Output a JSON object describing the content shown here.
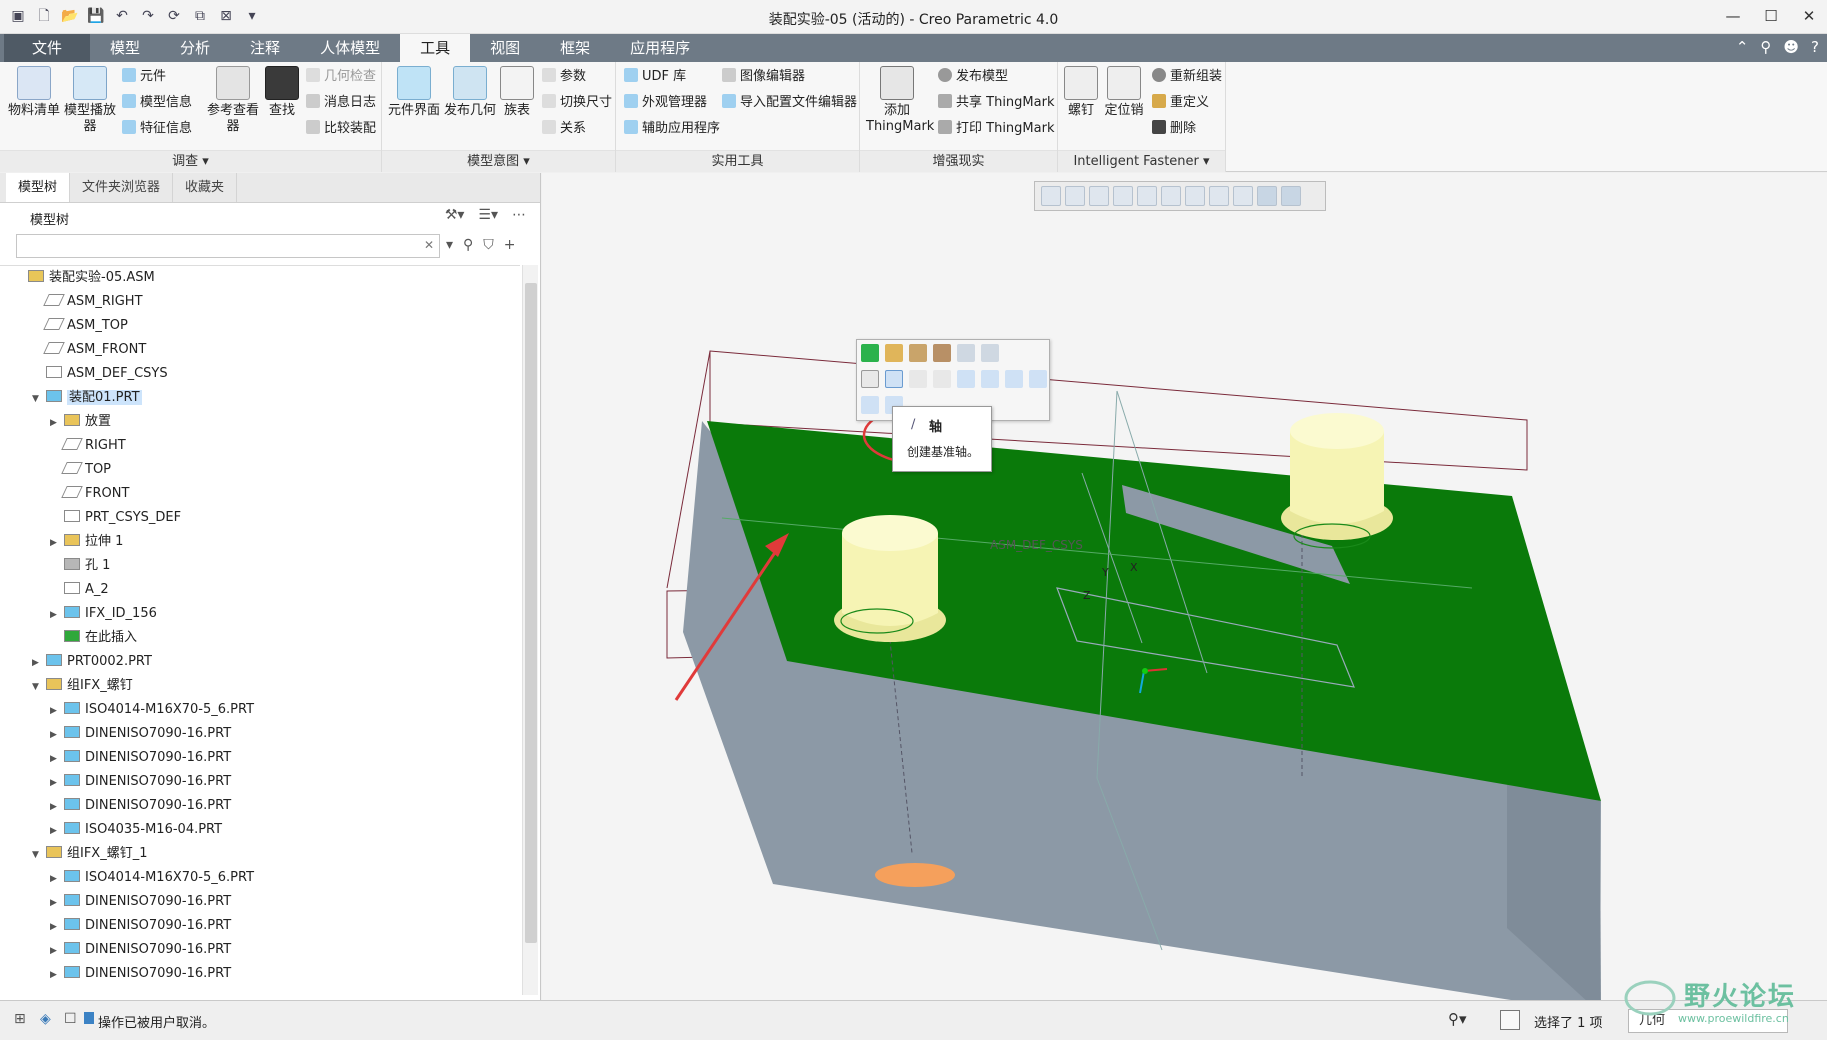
{
  "window": {
    "title": "装配实验-05 (活动的) - Creo Parametric 4.0"
  },
  "tabs": [
    {
      "label": "文件"
    },
    {
      "label": "模型"
    },
    {
      "label": "分析"
    },
    {
      "label": "注释"
    },
    {
      "label": "人体模型"
    },
    {
      "label": "工具"
    },
    {
      "label": "视图"
    },
    {
      "label": "框架"
    },
    {
      "label": "应用程序"
    }
  ],
  "ribbon": {
    "investigate": {
      "label": "调查 ▾",
      "bom": "物料清单",
      "model_player": "模型播放器",
      "component": "元件",
      "model_info": "模型信息",
      "feature_info": "特征信息",
      "ref_viewer": "参考查看器",
      "find": "查找",
      "geom_check": "几何检查",
      "msg_log": "消息日志",
      "compare_asm": "比较装配"
    },
    "model_intent": {
      "label": "模型意图 ▾",
      "component_interface": "元件界面",
      "publish_geom": "发布几何",
      "family_table": "族表",
      "params": "参数",
      "switch_dims": "切换尺寸",
      "relations": "关系"
    },
    "utilities": {
      "label": "实用工具",
      "udf_lib": "UDF 库",
      "appearance_mgr": "外观管理器",
      "aux_apps": "辅助应用程序",
      "image_editor": "图像编辑器",
      "import_config_editor": "导入配置文件编辑器"
    },
    "ar": {
      "label": "增强现实",
      "add_thingmark": "添加 ThingMark",
      "publish_model": "发布模型",
      "share_thingmark": "共享 ThingMark",
      "print_thingmark": "打印 ThingMark"
    },
    "fastener": {
      "label": "Intelligent Fastener ▾",
      "screw": "螺钉",
      "pin": "定位销",
      "reassemble": "重新组装",
      "redefine": "重定义",
      "delete": "删除"
    }
  },
  "panel": {
    "tabs": [
      "模型树",
      "文件夹浏览器",
      "收藏夹"
    ],
    "header": "模型树",
    "search_value": ""
  },
  "tree": [
    {
      "label": "装配实验-05.ASM",
      "level": 0,
      "toggle": "",
      "icon": "asm"
    },
    {
      "label": "ASM_RIGHT",
      "level": 1,
      "toggle": "",
      "icon": "plane"
    },
    {
      "label": "ASM_TOP",
      "level": 1,
      "toggle": "",
      "icon": "plane"
    },
    {
      "label": "ASM_FRONT",
      "level": 1,
      "toggle": "",
      "icon": "plane"
    },
    {
      "label": "ASM_DEF_CSYS",
      "level": 1,
      "toggle": "",
      "icon": "csys"
    },
    {
      "label": "装配01.PRT",
      "level": 1,
      "toggle": "▼",
      "icon": "part",
      "selected": true
    },
    {
      "label": "放置",
      "level": 2,
      "toggle": "▶",
      "icon": "folder"
    },
    {
      "label": "RIGHT",
      "level": 2,
      "toggle": "",
      "icon": "plane"
    },
    {
      "label": "TOP",
      "level": 2,
      "toggle": "",
      "icon": "plane"
    },
    {
      "label": "FRONT",
      "level": 2,
      "toggle": "",
      "icon": "plane"
    },
    {
      "label": "PRT_CSYS_DEF",
      "level": 2,
      "toggle": "",
      "icon": "csys"
    },
    {
      "label": "拉伸 1",
      "level": 2,
      "toggle": "▶",
      "icon": "extrude"
    },
    {
      "label": "孔 1",
      "level": 2,
      "toggle": "",
      "icon": "hole"
    },
    {
      "label": "A_2",
      "level": 2,
      "toggle": "",
      "icon": "axis"
    },
    {
      "label": "IFX_ID_156",
      "level": 2,
      "toggle": "▶",
      "icon": "part"
    },
    {
      "label": "在此插入",
      "level": 2,
      "toggle": "",
      "icon": "insert"
    },
    {
      "label": "PRT0002.PRT",
      "level": 1,
      "toggle": "▶",
      "icon": "part"
    },
    {
      "label": "组IFX_螺钉",
      "level": 1,
      "toggle": "▼",
      "icon": "group"
    },
    {
      "label": "ISO4014-M16X70-5_6.PRT",
      "level": 2,
      "toggle": "▶",
      "icon": "part"
    },
    {
      "label": "DINENISO7090-16.PRT",
      "level": 2,
      "toggle": "▶",
      "icon": "part"
    },
    {
      "label": "DINENISO7090-16.PRT",
      "level": 2,
      "toggle": "▶",
      "icon": "part"
    },
    {
      "label": "DINENISO7090-16.PRT",
      "level": 2,
      "toggle": "▶",
      "icon": "part"
    },
    {
      "label": "DINENISO7090-16.PRT",
      "level": 2,
      "toggle": "▶",
      "icon": "part"
    },
    {
      "label": "ISO4035-M16-04.PRT",
      "level": 2,
      "toggle": "▶",
      "icon": "part"
    },
    {
      "label": "组IFX_螺钉_1",
      "level": 1,
      "toggle": "▼",
      "icon": "group"
    },
    {
      "label": "ISO4014-M16X70-5_6.PRT",
      "level": 2,
      "toggle": "▶",
      "icon": "part"
    },
    {
      "label": "DINENISO7090-16.PRT",
      "level": 2,
      "toggle": "▶",
      "icon": "part"
    },
    {
      "label": "DINENISO7090-16.PRT",
      "level": 2,
      "toggle": "▶",
      "icon": "part"
    },
    {
      "label": "DINENISO7090-16.PRT",
      "level": 2,
      "toggle": "▶",
      "icon": "part"
    },
    {
      "label": "DINENISO7090-16.PRT",
      "level": 2,
      "toggle": "▶",
      "icon": "part"
    }
  ],
  "tooltip": {
    "title": "轴",
    "desc": "创建基准轴。"
  },
  "graphics": {
    "csys_label": "ASM_DEF_CSYS",
    "axis_x": "X",
    "axis_y": "Y",
    "axis_z": "Z"
  },
  "status": {
    "message": "操作已被用户取消。",
    "selection": "选择了 1 项",
    "filter": "几何"
  },
  "watermark": {
    "brand": "野火论坛",
    "url": "www.proewildfire.cn"
  },
  "colors": {
    "tab_bar": "#6e7a86",
    "green_face": "#0a7a0a",
    "grey_block": "#8a97a5",
    "bolt_yellow": "#f6f4b4",
    "annotation_red": "#e03a3a"
  }
}
